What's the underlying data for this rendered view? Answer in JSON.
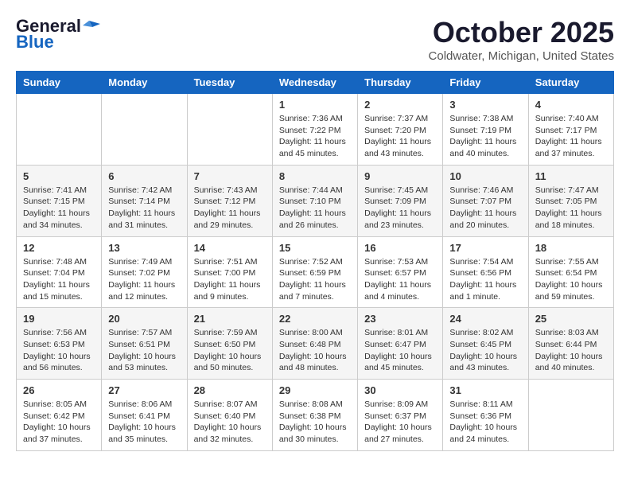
{
  "header": {
    "logo_general": "General",
    "logo_blue": "Blue",
    "month": "October 2025",
    "location": "Coldwater, Michigan, United States"
  },
  "columns": [
    "Sunday",
    "Monday",
    "Tuesday",
    "Wednesday",
    "Thursday",
    "Friday",
    "Saturday"
  ],
  "weeks": [
    [
      {
        "day": "",
        "info": ""
      },
      {
        "day": "",
        "info": ""
      },
      {
        "day": "",
        "info": ""
      },
      {
        "day": "1",
        "info": "Sunrise: 7:36 AM\nSunset: 7:22 PM\nDaylight: 11 hours and 45 minutes."
      },
      {
        "day": "2",
        "info": "Sunrise: 7:37 AM\nSunset: 7:20 PM\nDaylight: 11 hours and 43 minutes."
      },
      {
        "day": "3",
        "info": "Sunrise: 7:38 AM\nSunset: 7:19 PM\nDaylight: 11 hours and 40 minutes."
      },
      {
        "day": "4",
        "info": "Sunrise: 7:40 AM\nSunset: 7:17 PM\nDaylight: 11 hours and 37 minutes."
      }
    ],
    [
      {
        "day": "5",
        "info": "Sunrise: 7:41 AM\nSunset: 7:15 PM\nDaylight: 11 hours and 34 minutes."
      },
      {
        "day": "6",
        "info": "Sunrise: 7:42 AM\nSunset: 7:14 PM\nDaylight: 11 hours and 31 minutes."
      },
      {
        "day": "7",
        "info": "Sunrise: 7:43 AM\nSunset: 7:12 PM\nDaylight: 11 hours and 29 minutes."
      },
      {
        "day": "8",
        "info": "Sunrise: 7:44 AM\nSunset: 7:10 PM\nDaylight: 11 hours and 26 minutes."
      },
      {
        "day": "9",
        "info": "Sunrise: 7:45 AM\nSunset: 7:09 PM\nDaylight: 11 hours and 23 minutes."
      },
      {
        "day": "10",
        "info": "Sunrise: 7:46 AM\nSunset: 7:07 PM\nDaylight: 11 hours and 20 minutes."
      },
      {
        "day": "11",
        "info": "Sunrise: 7:47 AM\nSunset: 7:05 PM\nDaylight: 11 hours and 18 minutes."
      }
    ],
    [
      {
        "day": "12",
        "info": "Sunrise: 7:48 AM\nSunset: 7:04 PM\nDaylight: 11 hours and 15 minutes."
      },
      {
        "day": "13",
        "info": "Sunrise: 7:49 AM\nSunset: 7:02 PM\nDaylight: 11 hours and 12 minutes."
      },
      {
        "day": "14",
        "info": "Sunrise: 7:51 AM\nSunset: 7:00 PM\nDaylight: 11 hours and 9 minutes."
      },
      {
        "day": "15",
        "info": "Sunrise: 7:52 AM\nSunset: 6:59 PM\nDaylight: 11 hours and 7 minutes."
      },
      {
        "day": "16",
        "info": "Sunrise: 7:53 AM\nSunset: 6:57 PM\nDaylight: 11 hours and 4 minutes."
      },
      {
        "day": "17",
        "info": "Sunrise: 7:54 AM\nSunset: 6:56 PM\nDaylight: 11 hours and 1 minute."
      },
      {
        "day": "18",
        "info": "Sunrise: 7:55 AM\nSunset: 6:54 PM\nDaylight: 10 hours and 59 minutes."
      }
    ],
    [
      {
        "day": "19",
        "info": "Sunrise: 7:56 AM\nSunset: 6:53 PM\nDaylight: 10 hours and 56 minutes."
      },
      {
        "day": "20",
        "info": "Sunrise: 7:57 AM\nSunset: 6:51 PM\nDaylight: 10 hours and 53 minutes."
      },
      {
        "day": "21",
        "info": "Sunrise: 7:59 AM\nSunset: 6:50 PM\nDaylight: 10 hours and 50 minutes."
      },
      {
        "day": "22",
        "info": "Sunrise: 8:00 AM\nSunset: 6:48 PM\nDaylight: 10 hours and 48 minutes."
      },
      {
        "day": "23",
        "info": "Sunrise: 8:01 AM\nSunset: 6:47 PM\nDaylight: 10 hours and 45 minutes."
      },
      {
        "day": "24",
        "info": "Sunrise: 8:02 AM\nSunset: 6:45 PM\nDaylight: 10 hours and 43 minutes."
      },
      {
        "day": "25",
        "info": "Sunrise: 8:03 AM\nSunset: 6:44 PM\nDaylight: 10 hours and 40 minutes."
      }
    ],
    [
      {
        "day": "26",
        "info": "Sunrise: 8:05 AM\nSunset: 6:42 PM\nDaylight: 10 hours and 37 minutes."
      },
      {
        "day": "27",
        "info": "Sunrise: 8:06 AM\nSunset: 6:41 PM\nDaylight: 10 hours and 35 minutes."
      },
      {
        "day": "28",
        "info": "Sunrise: 8:07 AM\nSunset: 6:40 PM\nDaylight: 10 hours and 32 minutes."
      },
      {
        "day": "29",
        "info": "Sunrise: 8:08 AM\nSunset: 6:38 PM\nDaylight: 10 hours and 30 minutes."
      },
      {
        "day": "30",
        "info": "Sunrise: 8:09 AM\nSunset: 6:37 PM\nDaylight: 10 hours and 27 minutes."
      },
      {
        "day": "31",
        "info": "Sunrise: 8:11 AM\nSunset: 6:36 PM\nDaylight: 10 hours and 24 minutes."
      },
      {
        "day": "",
        "info": ""
      }
    ]
  ]
}
